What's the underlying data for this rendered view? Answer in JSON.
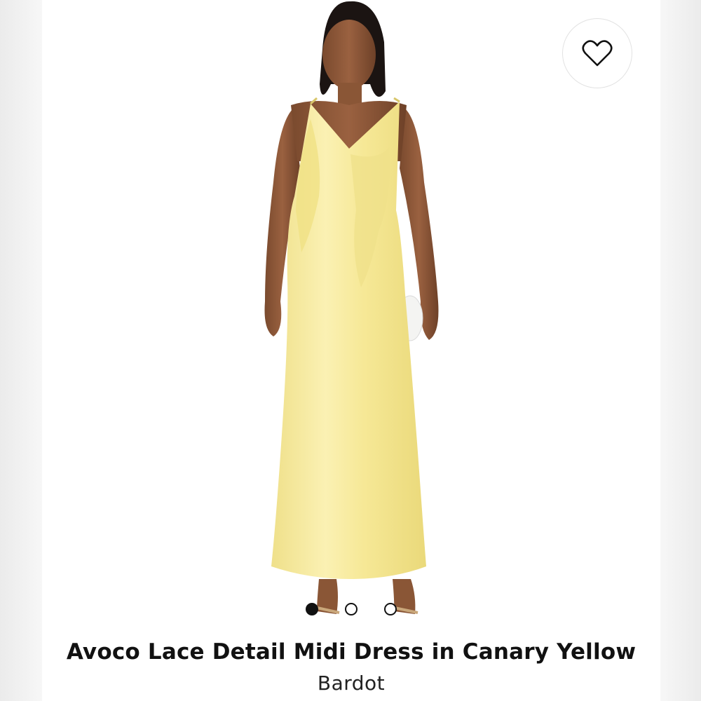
{
  "product": {
    "title": "Avoco Lace Detail Midi Dress in Canary Yellow",
    "brand": "Bardot"
  },
  "gallery": {
    "image_count": 3,
    "active_index": 0,
    "dress_color": "#f6ea9e"
  },
  "favorite": {
    "icon": "heart-icon",
    "active": false
  },
  "colors": {
    "text": "#111111",
    "background": "#ffffff"
  }
}
